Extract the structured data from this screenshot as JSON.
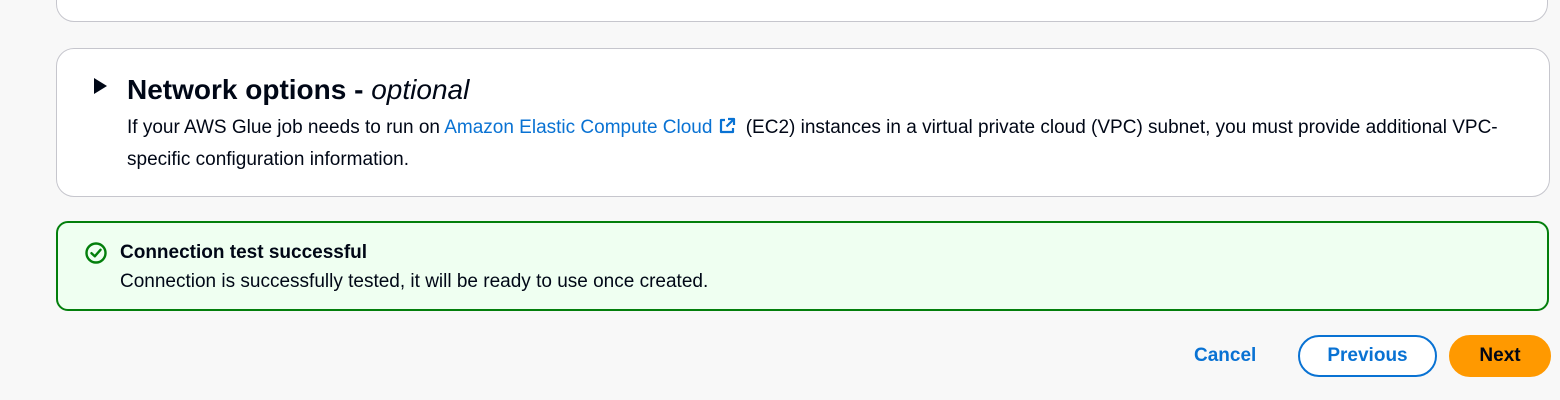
{
  "network_options": {
    "title": "Network options - ",
    "title_optional": "optional",
    "expand_icon": "caret-right-icon",
    "description_before_link": "If your AWS Glue job needs to run on ",
    "link_text": "Amazon Elastic Compute Cloud",
    "link_icon": "external-link-icon",
    "description_after_link": " (EC2) instances in a virtual private cloud (VPC) subnet, you must provide additional VPC-specific configuration information."
  },
  "alert": {
    "type": "success",
    "icon": "status-positive-icon",
    "title": "Connection test successful",
    "message": "Connection is successfully tested, it will be ready to use once created.",
    "color": "#037f0c",
    "background": "#effff1"
  },
  "actions": {
    "cancel_label": "Cancel",
    "previous_label": "Previous",
    "next_label": "Next",
    "primary_color": "#ff9900",
    "link_color": "#0972d3"
  }
}
